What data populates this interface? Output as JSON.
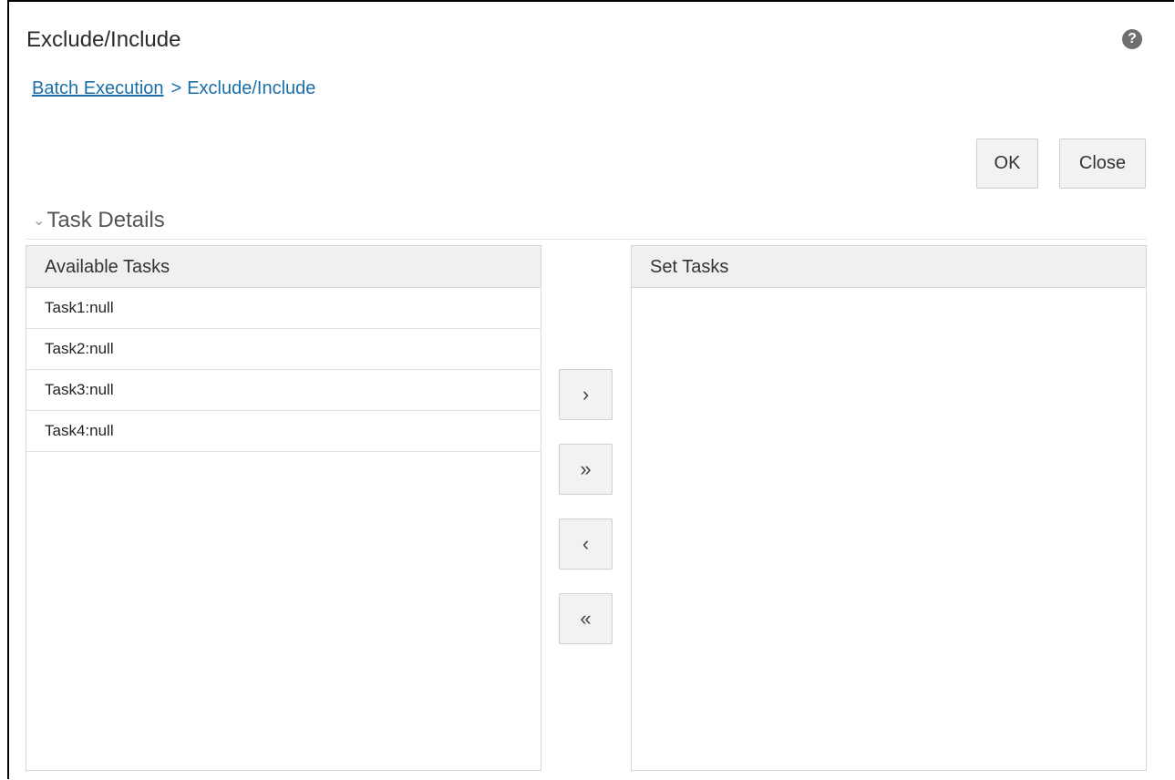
{
  "page": {
    "title": "Exclude/Include",
    "help_icon": "?"
  },
  "breadcrumb": {
    "parent_link": "Batch Execution",
    "separator": ">",
    "current": "Exclude/Include"
  },
  "actions": {
    "ok_label": "OK",
    "close_label": "Close"
  },
  "section": {
    "title": "Task Details",
    "collapse_icon": "chevron-down-icon"
  },
  "available": {
    "header": "Available Tasks",
    "items": [
      "Task1:null",
      "Task2:null",
      "Task3:null",
      "Task4:null"
    ]
  },
  "selected": {
    "header": "Set Tasks",
    "items": []
  },
  "shuttle": {
    "move_one": "›",
    "move_all": "»",
    "remove_one": "‹",
    "remove_all": "«"
  },
  "colors": {
    "link": "#1a6fa8",
    "header_bg": "#f0f0f0",
    "button_bg": "#f2f2f2"
  }
}
